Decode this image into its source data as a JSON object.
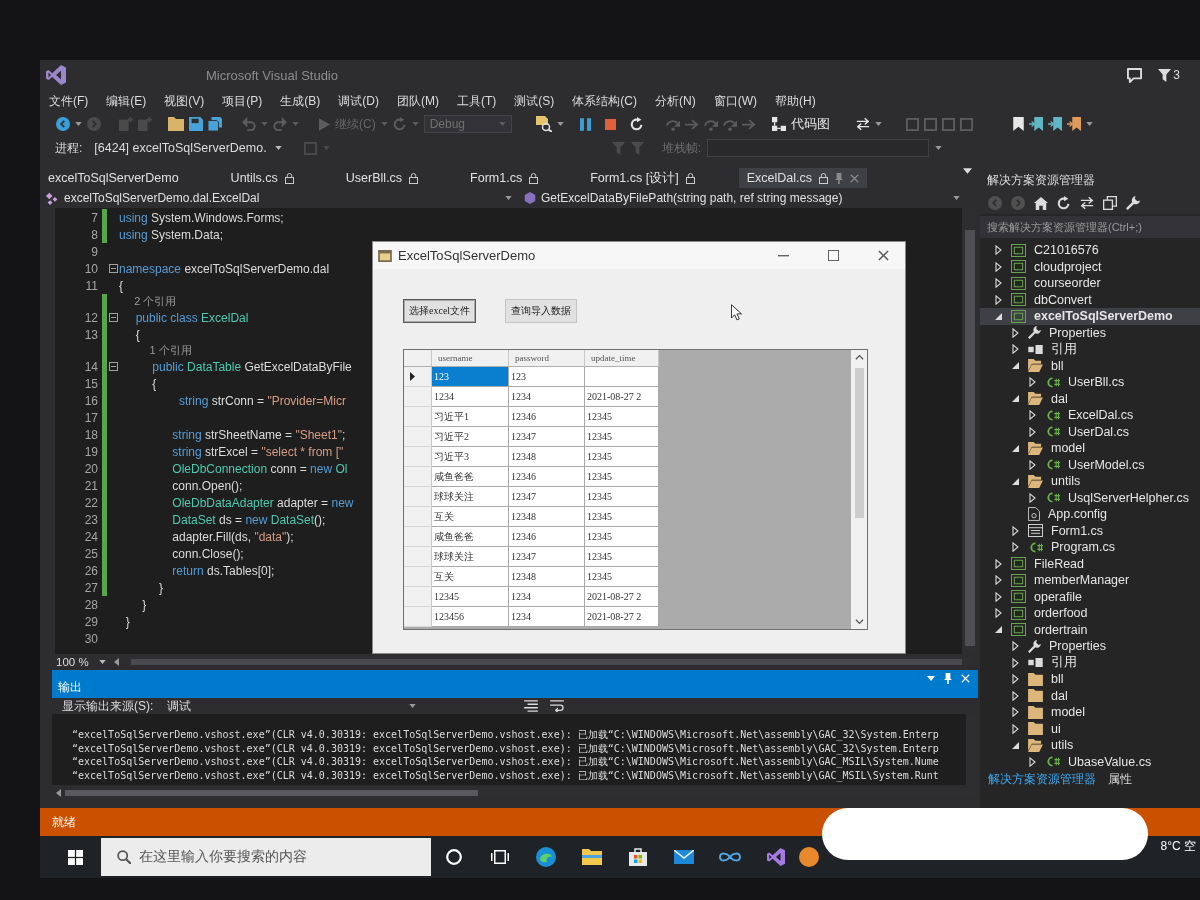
{
  "window": {
    "title": "Microsoft Visual Studio",
    "notifications": "3"
  },
  "menu": [
    "文件(F)",
    "编辑(E)",
    "视图(V)",
    "项目(P)",
    "生成(B)",
    "调试(D)",
    "团队(M)",
    "工具(T)",
    "测试(S)",
    "体系结构(C)",
    "分析(N)",
    "窗口(W)",
    "帮助(H)"
  ],
  "toolbar": {
    "continue": {
      "label": "继续(C)",
      "disabled": true
    },
    "configuration": {
      "value": "Debug",
      "disabled": true
    },
    "code_map": "代码图"
  },
  "debug_location": {
    "process_label": "进程:",
    "process": "[6424] excelToSqlServerDemo.",
    "stack_frame_label": "堆栈帧:"
  },
  "editor": {
    "tabs": [
      {
        "label": "excelToSqlServerDemo",
        "locked": false,
        "selected": false
      },
      {
        "label": "Untils.cs",
        "locked": true,
        "selected": false
      },
      {
        "label": "UserBll.cs",
        "locked": true,
        "selected": false
      },
      {
        "label": "Form1.cs",
        "locked": true,
        "selected": false
      },
      {
        "label": "Form1.cs [设计]",
        "locked": true,
        "selected": false
      },
      {
        "label": "ExcelDal.cs",
        "locked": true,
        "selected": true
      }
    ],
    "nav": {
      "type_path": "excelToSqlServerDemo.dal.ExcelDal",
      "member": "GetExcelDataByFilePath(string path, ref string message)"
    },
    "lines": [
      {
        "kind": "code",
        "number": "7",
        "changed": true,
        "fold": false,
        "tokens": [
          {
            "kind": "keyword",
            "text": "using"
          },
          {
            "kind": "plain",
            "text": " System.Windows.Forms;"
          }
        ]
      },
      {
        "kind": "code",
        "number": "8",
        "changed": true,
        "fold": false,
        "tokens": [
          {
            "kind": "keyword",
            "text": "using"
          },
          {
            "kind": "plain",
            "text": " System.Data;"
          }
        ]
      },
      {
        "kind": "code",
        "number": "9",
        "changed": false,
        "fold": false
      },
      {
        "kind": "code",
        "number": "10",
        "changed": false,
        "fold": true,
        "tokens": [
          {
            "kind": "keyword",
            "text": "namespace"
          },
          {
            "kind": "plain",
            "text": " excelToSqlServerDemo.dal"
          }
        ]
      },
      {
        "kind": "code",
        "number": "11",
        "changed": false,
        "fold": false,
        "tokens": [
          {
            "kind": "plain",
            "text": "{"
          }
        ]
      },
      {
        "kind": "codelens",
        "changed": true,
        "text": "     2 个引用"
      },
      {
        "kind": "code",
        "number": "12",
        "changed": true,
        "fold": true,
        "tokens": [
          {
            "kind": "keyword",
            "text": "     public class"
          },
          {
            "kind": "type",
            "text": " ExcelDal"
          }
        ]
      },
      {
        "kind": "code",
        "number": "13",
        "changed": true,
        "fold": false,
        "tokens": [
          {
            "kind": "plain",
            "text": "     {"
          }
        ]
      },
      {
        "kind": "codelens",
        "changed": true,
        "text": "          1 个引用"
      },
      {
        "kind": "code",
        "number": "14",
        "changed": true,
        "fold": true,
        "tokens": [
          {
            "kind": "keyword",
            "text": "          public"
          },
          {
            "kind": "type",
            "text": " DataTable"
          },
          {
            "kind": "plain",
            "text": " GetExcelDataByFile"
          }
        ]
      },
      {
        "kind": "code",
        "number": "15",
        "changed": true,
        "fold": false,
        "tokens": [
          {
            "kind": "plain",
            "text": "          {"
          }
        ]
      },
      {
        "kind": "code",
        "number": "16",
        "changed": true,
        "fold": false,
        "tokens": [
          {
            "kind": "keyword",
            "text": "                  string"
          },
          {
            "kind": "plain",
            "text": " strConn = "
          },
          {
            "kind": "string",
            "text": "\"Provider=Micr"
          }
        ]
      },
      {
        "kind": "code",
        "number": "17",
        "changed": true,
        "fold": false
      },
      {
        "kind": "code",
        "number": "18",
        "changed": true,
        "fold": false,
        "tokens": [
          {
            "kind": "keyword",
            "text": "                string"
          },
          {
            "kind": "plain",
            "text": " strSheetName = "
          },
          {
            "kind": "string",
            "text": "\"Sheet1\""
          },
          {
            "kind": "plain",
            "text": ";"
          }
        ]
      },
      {
        "kind": "code",
        "number": "19",
        "changed": true,
        "fold": false,
        "tokens": [
          {
            "kind": "keyword",
            "text": "                string"
          },
          {
            "kind": "plain",
            "text": " strExcel = "
          },
          {
            "kind": "string",
            "text": "\"select * from [\""
          }
        ]
      },
      {
        "kind": "code",
        "number": "20",
        "changed": true,
        "fold": false,
        "tokens": [
          {
            "kind": "type",
            "text": "                OleDbConnection"
          },
          {
            "kind": "plain",
            "text": " conn = "
          },
          {
            "kind": "keyword",
            "text": "new"
          },
          {
            "kind": "type",
            "text": " Ol"
          }
        ]
      },
      {
        "kind": "code",
        "number": "21",
        "changed": true,
        "fold": false,
        "tokens": [
          {
            "kind": "plain",
            "text": "                conn.Open();"
          }
        ]
      },
      {
        "kind": "code",
        "number": "22",
        "changed": true,
        "fold": false,
        "tokens": [
          {
            "kind": "type",
            "text": "                OleDbDataAdapter"
          },
          {
            "kind": "plain",
            "text": " adapter = "
          },
          {
            "kind": "keyword",
            "text": "new"
          }
        ]
      },
      {
        "kind": "code",
        "number": "23",
        "changed": true,
        "fold": false,
        "tokens": [
          {
            "kind": "type",
            "text": "                DataSet"
          },
          {
            "kind": "plain",
            "text": " ds = "
          },
          {
            "kind": "keyword",
            "text": "new"
          },
          {
            "kind": "type",
            "text": " DataSet"
          },
          {
            "kind": "plain",
            "text": "();"
          }
        ]
      },
      {
        "kind": "code",
        "number": "24",
        "changed": true,
        "fold": false,
        "tokens": [
          {
            "kind": "plain",
            "text": "                adapter.Fill(ds, "
          },
          {
            "kind": "string",
            "text": "\"data\""
          },
          {
            "kind": "plain",
            "text": ");"
          }
        ]
      },
      {
        "kind": "code",
        "number": "25",
        "changed": true,
        "fold": false,
        "tokens": [
          {
            "kind": "plain",
            "text": "                conn.Close();"
          }
        ]
      },
      {
        "kind": "code",
        "number": "26",
        "changed": true,
        "fold": false,
        "tokens": [
          {
            "kind": "keyword",
            "text": "                return"
          },
          {
            "kind": "plain",
            "text": " ds.Tables[0];"
          }
        ]
      },
      {
        "kind": "code",
        "number": "27",
        "changed": true,
        "fold": false,
        "tokens": [
          {
            "kind": "plain",
            "text": "            }"
          }
        ]
      },
      {
        "kind": "code",
        "number": "28",
        "changed": false,
        "fold": false,
        "tokens": [
          {
            "kind": "plain",
            "text": "       }"
          }
        ]
      },
      {
        "kind": "code",
        "number": "29",
        "changed": false,
        "fold": false,
        "tokens": [
          {
            "kind": "plain",
            "text": "  }"
          }
        ]
      },
      {
        "kind": "code",
        "number": "30",
        "changed": false,
        "fold": false
      }
    ],
    "zoom": "100 %"
  },
  "running_form": {
    "title": "ExcelToSqlServerDemo",
    "buttons": [
      {
        "label": "选择excel文件",
        "focused": true
      },
      {
        "label": "查询导入数据",
        "focused": false
      }
    ],
    "grid": {
      "columns": [
        "username",
        "password",
        "update_time"
      ],
      "rows": [
        {
          "current": true,
          "cells": [
            {
              "text": "123",
              "selected": true
            },
            {
              "text": "123",
              "selected": false
            },
            {
              "selected": false
            }
          ]
        },
        {
          "current": false,
          "cells": [
            {
              "text": "1234",
              "selected": false
            },
            {
              "text": "1234",
              "selected": false
            },
            {
              "text": "2021-08-27 2",
              "selected": false
            }
          ]
        },
        {
          "current": false,
          "cells": [
            {
              "text": "习近平1",
              "selected": false
            },
            {
              "text": "12346",
              "selected": false
            },
            {
              "text": "12345",
              "selected": false
            }
          ]
        },
        {
          "current": false,
          "cells": [
            {
              "text": "习近平2",
              "selected": false
            },
            {
              "text": "12347",
              "selected": false
            },
            {
              "text": "12345",
              "selected": false
            }
          ]
        },
        {
          "current": false,
          "cells": [
            {
              "text": "习近平3",
              "selected": false
            },
            {
              "text": "12348",
              "selected": false
            },
            {
              "text": "12345",
              "selected": false
            }
          ]
        },
        {
          "current": false,
          "cells": [
            {
              "text": "咸鱼爸爸",
              "selected": false
            },
            {
              "text": "12346",
              "selected": false
            },
            {
              "text": "12345",
              "selected": false
            }
          ]
        },
        {
          "current": false,
          "cells": [
            {
              "text": "球球关注",
              "selected": false
            },
            {
              "text": "12347",
              "selected": false
            },
            {
              "text": "12345",
              "selected": false
            }
          ]
        },
        {
          "current": false,
          "cells": [
            {
              "text": "互关",
              "selected": false
            },
            {
              "text": "12348",
              "selected": false
            },
            {
              "text": "12345",
              "selected": false
            }
          ]
        },
        {
          "current": false,
          "cells": [
            {
              "text": "咸鱼爸爸",
              "selected": false
            },
            {
              "text": "12346",
              "selected": false
            },
            {
              "text": "12345",
              "selected": false
            }
          ]
        },
        {
          "current": false,
          "cells": [
            {
              "text": "球球关注",
              "selected": false
            },
            {
              "text": "12347",
              "selected": false
            },
            {
              "text": "12345",
              "selected": false
            }
          ]
        },
        {
          "current": false,
          "cells": [
            {
              "text": "互关",
              "selected": false
            },
            {
              "text": "12348",
              "selected": false
            },
            {
              "text": "12345",
              "selected": false
            }
          ]
        },
        {
          "current": false,
          "cells": [
            {
              "text": "12345",
              "selected": false
            },
            {
              "text": "1234",
              "selected": false
            },
            {
              "text": "2021-08-27 2",
              "selected": false
            }
          ]
        },
        {
          "current": false,
          "cells": [
            {
              "text": "123456",
              "selected": false
            },
            {
              "text": "1234",
              "selected": false
            },
            {
              "text": "2021-08-27 2",
              "selected": false
            }
          ]
        }
      ]
    }
  },
  "output": {
    "title": "输出",
    "source_label": "显示输出来源(S):",
    "source": "调试",
    "lines": [
      "“excelToSqlServerDemo.vshost.exe”(CLR v4.0.30319: excelToSqlServerDemo.vshost.exe): 已加载“C:\\WINDOWS\\Microsoft.Net\\assembly\\GAC_32\\System.Enterp",
      "“excelToSqlServerDemo.vshost.exe”(CLR v4.0.30319: excelToSqlServerDemo.vshost.exe): 已加载“C:\\WINDOWS\\Microsoft.Net\\assembly\\GAC_32\\System.Enterp",
      "“excelToSqlServerDemo.vshost.exe”(CLR v4.0.30319: excelToSqlServerDemo.vshost.exe): 已加载“C:\\WINDOWS\\Microsoft.Net\\assembly\\GAC_MSIL\\System.Nume",
      "“excelToSqlServerDemo.vshost.exe”(CLR v4.0.30319: excelToSqlServerDemo.vshost.exe): 已加载“C:\\WINDOWS\\Microsoft.Net\\assembly\\GAC_MSIL\\System.Runt"
    ]
  },
  "solution_explorer": {
    "title": "解决方案资源管理器",
    "search": {
      "placeholder": "搜索解决方案资源管理器(Ctrl+;)"
    },
    "tree": [
      {
        "label": "C21016576",
        "kind": "project",
        "expanded": false,
        "selected": false
      },
      {
        "label": "cloudproject",
        "kind": "project",
        "expanded": false,
        "selected": false
      },
      {
        "label": "courseorder",
        "kind": "project",
        "expanded": false,
        "selected": false
      },
      {
        "label": "dbConvert",
        "kind": "project",
        "expanded": false,
        "selected": false
      },
      {
        "label": "excelToSqlServerDemo",
        "kind": "project",
        "expanded": true,
        "selected": true,
        "children": [
          {
            "label": "Properties",
            "kind": "properties",
            "expanded": false,
            "selected": false
          },
          {
            "label": "引用",
            "kind": "references",
            "expanded": false,
            "selected": false
          },
          {
            "label": "bll",
            "kind": "folder",
            "expanded": true,
            "selected": false,
            "children": [
              {
                "label": "UserBll.cs",
                "kind": "code_file",
                "expanded": false,
                "selected": false
              }
            ]
          },
          {
            "label": "dal",
            "kind": "folder",
            "expanded": true,
            "selected": false,
            "children": [
              {
                "label": "ExcelDal.cs",
                "kind": "code_file",
                "expanded": false,
                "selected": false
              },
              {
                "label": "UserDal.cs",
                "kind": "code_file",
                "expanded": false,
                "selected": false
              }
            ]
          },
          {
            "label": "model",
            "kind": "folder",
            "expanded": true,
            "selected": false,
            "children": [
              {
                "label": "UserModel.cs",
                "kind": "code_file",
                "expanded": false,
                "selected": false
              }
            ]
          },
          {
            "label": "untils",
            "kind": "folder",
            "expanded": true,
            "selected": false,
            "children": [
              {
                "label": "UsqlServerHelpher.cs",
                "kind": "code_file",
                "expanded": false,
                "selected": false
              }
            ]
          },
          {
            "label": "App.config",
            "kind": "config",
            "selected": false
          },
          {
            "label": "Form1.cs",
            "kind": "form",
            "expanded": false,
            "selected": false
          },
          {
            "label": "Program.cs",
            "kind": "code_file",
            "expanded": false,
            "selected": false
          }
        ]
      },
      {
        "label": "FileRead",
        "kind": "project",
        "expanded": false,
        "selected": false
      },
      {
        "label": "memberManager",
        "kind": "project",
        "expanded": false,
        "selected": false
      },
      {
        "label": "operafile",
        "kind": "project",
        "expanded": false,
        "selected": false
      },
      {
        "label": "orderfood",
        "kind": "project",
        "expanded": false,
        "selected": false
      },
      {
        "label": "ordertrain",
        "kind": "project",
        "expanded": true,
        "selected": false,
        "children": [
          {
            "label": "Properties",
            "kind": "properties",
            "expanded": false,
            "selected": false
          },
          {
            "label": "引用",
            "kind": "references",
            "expanded": false,
            "selected": false
          },
          {
            "label": "bll",
            "kind": "folder",
            "expanded": false,
            "selected": false
          },
          {
            "label": "dal",
            "kind": "folder",
            "expanded": false,
            "selected": false
          },
          {
            "label": "model",
            "kind": "folder",
            "expanded": false,
            "selected": false
          },
          {
            "label": "ui",
            "kind": "folder",
            "expanded": false,
            "selected": false
          },
          {
            "label": "utils",
            "kind": "folder",
            "expanded": true,
            "selected": false,
            "children": [
              {
                "label": "UbaseValue.cs",
                "kind": "code_file",
                "expanded": false,
                "selected": false
              }
            ]
          }
        ]
      }
    ],
    "tabs": [
      {
        "label": "解决方案资源管理器",
        "selected": true
      },
      {
        "label": "属性",
        "selected": false
      }
    ]
  },
  "status_bar": {
    "text": "就绪"
  },
  "taskbar": {
    "search": {
      "placeholder": "在这里输入你要搜索的内容"
    },
    "weather": "8°C 空"
  }
}
